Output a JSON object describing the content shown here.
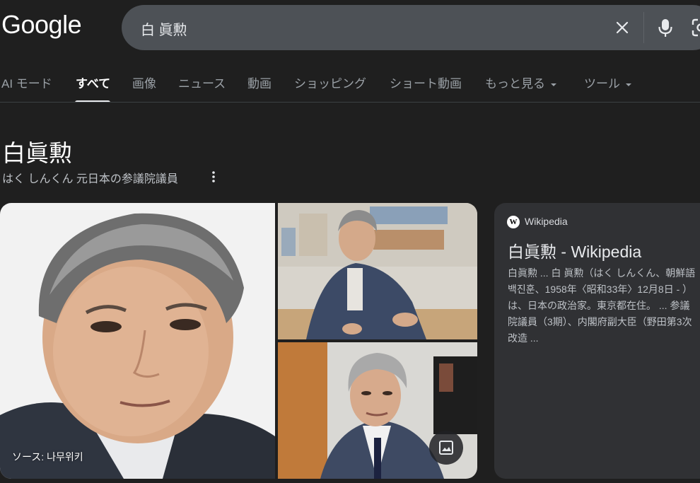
{
  "header": {
    "logo": "Google",
    "search_query": "白 眞勲"
  },
  "tabs": [
    {
      "label": "AI モード"
    },
    {
      "label": "すべて",
      "active": true
    },
    {
      "label": "画像"
    },
    {
      "label": "ニュース"
    },
    {
      "label": "動画"
    },
    {
      "label": "ショッピング"
    },
    {
      "label": "ショート動画"
    },
    {
      "label": "もっと見る"
    },
    {
      "label": "ツール"
    }
  ],
  "knowledge_panel": {
    "title": "白眞勲",
    "subtitle": "はく しんくん  元日本の参議院議員"
  },
  "images": {
    "source_label": "ソース: 나무위키"
  },
  "wiki_card": {
    "source": "Wikipedia",
    "title": "白眞勲 - Wikipedia",
    "snippet_lines": [
      "白眞勲 ... 白 眞勲（はく しんくん、朝鮮語",
      "백진훈、1958年〈昭和33年〉12月8日 - ）",
      "は、日本の政治家。東京都在住。 ... 参議",
      "院議員（3期）、内閣府副大臣（野田第3次",
      "改造 ..."
    ]
  },
  "colors": {
    "background": "#1f1f1f",
    "search_box": "#4d5156",
    "card": "#303134"
  }
}
